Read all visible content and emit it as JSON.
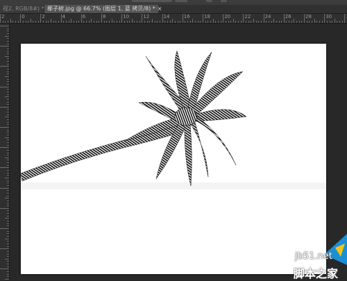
{
  "tabs": [
    {
      "label": "视2, RGB/8#) *",
      "close": "×",
      "active": false
    },
    {
      "label": "椰子树.jpg @ 66.7% (图层 1, 蓝 拷贝/8) *",
      "close": "×",
      "active": true
    }
  ],
  "ruler": {
    "labels": [
      "2",
      "0",
      "2",
      "4",
      "6",
      "8",
      "10",
      "12",
      "14",
      "16",
      "18",
      "20",
      "22",
      "24",
      "26",
      "28",
      "30",
      "32"
    ]
  },
  "watermark": {
    "url": "jb51.net",
    "name": "脚本之家"
  },
  "colors": {
    "workspace": "#282828",
    "tab_active": "#535353",
    "canvas": "#ffffff",
    "badge_blue": "#1a8fd6",
    "badge_yellow": "#f3c21b"
  },
  "icons": {
    "image": "palm-tree-halftone",
    "watermark_badge": "jb51-logo-icon"
  }
}
